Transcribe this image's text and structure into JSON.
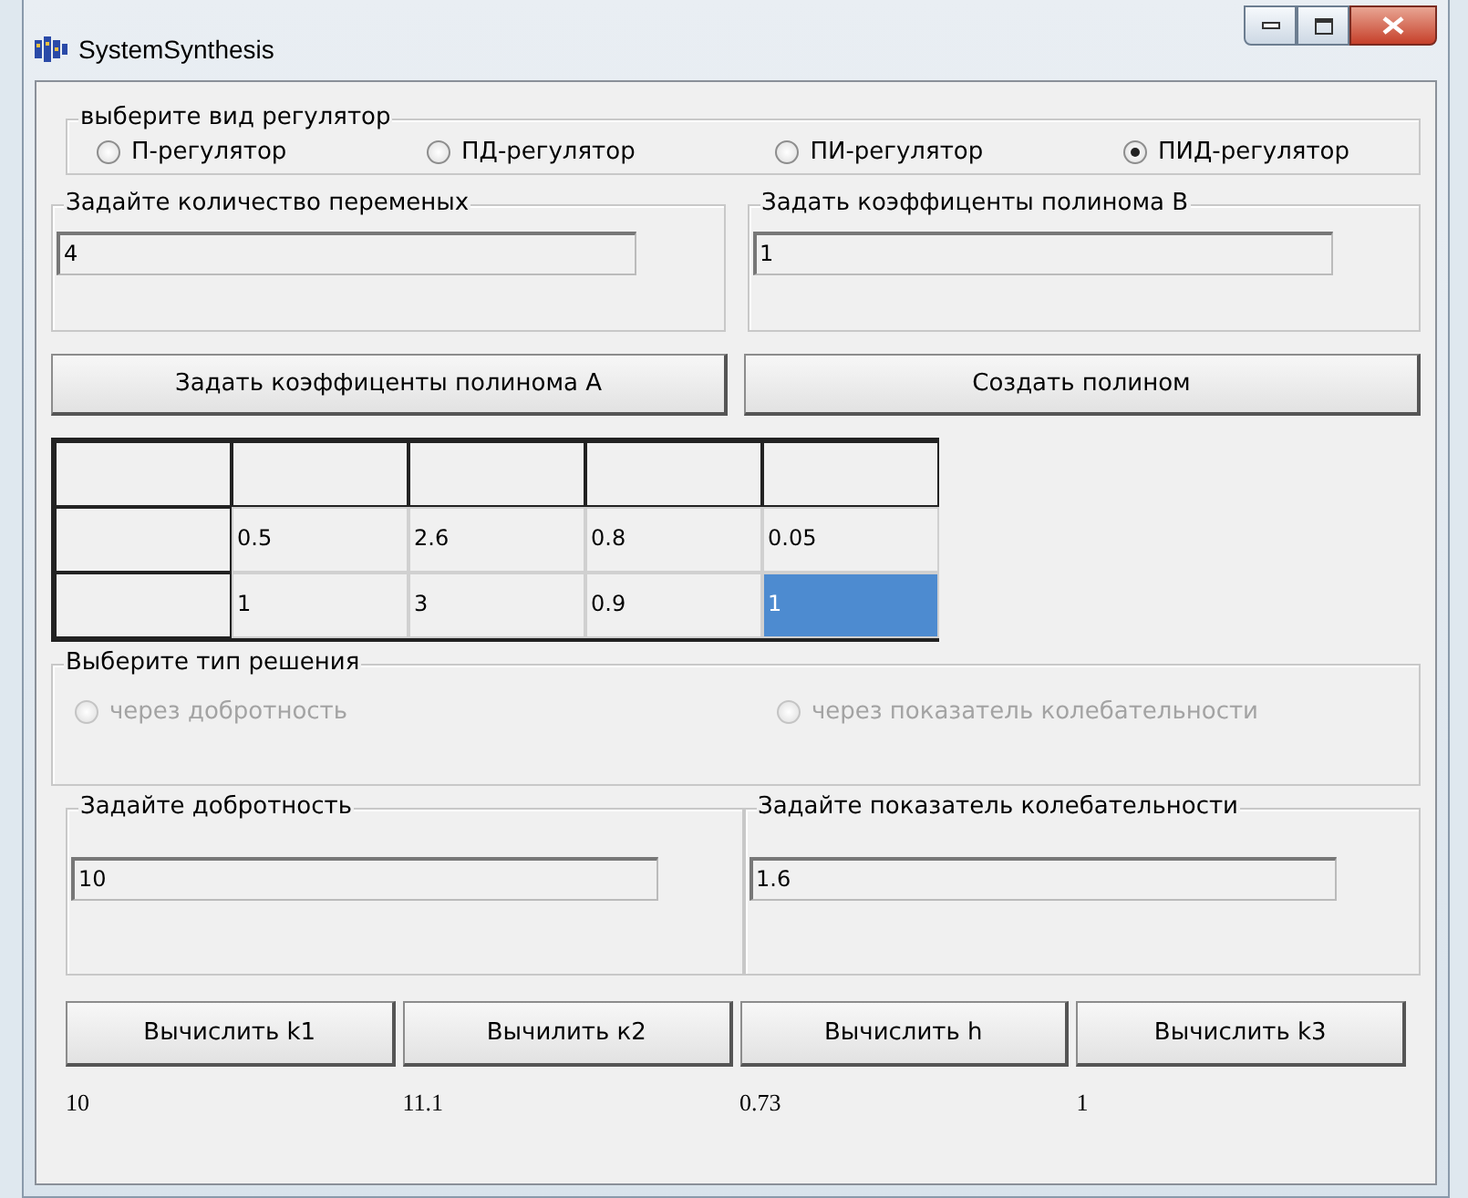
{
  "window": {
    "title": "SystemSynthesis"
  },
  "regulator_group": {
    "label": "выберите вид регулятор",
    "options": [
      {
        "label": "П-регулятор",
        "selected": false
      },
      {
        "label": "ПД-регулятор",
        "selected": false
      },
      {
        "label": "ПИ-регулятор",
        "selected": false
      },
      {
        "label": "ПИД-регулятор",
        "selected": true
      }
    ]
  },
  "variables_group": {
    "label": "Задайте количество переменых",
    "value": "4"
  },
  "poly_b_group": {
    "label": "Задать коэффиценты полинома B",
    "value": "1"
  },
  "poly_buttons": [
    "Задать коэффиценты полинома A",
    "Создать полином"
  ],
  "grid": {
    "rows": [
      {
        "cells": [
          {
            "value": "0.5",
            "selected": false
          },
          {
            "value": "2.6",
            "selected": false
          },
          {
            "value": "0.8",
            "selected": false
          },
          {
            "value": "0.05",
            "selected": false
          }
        ]
      },
      {
        "cells": [
          {
            "value": "1",
            "selected": false
          },
          {
            "value": "3",
            "selected": false
          },
          {
            "value": "0.9",
            "selected": false
          },
          {
            "value": "1",
            "selected": true
          }
        ]
      }
    ]
  },
  "solution_group": {
    "label": "Выберите тип решения",
    "options": [
      {
        "label": "через добротность",
        "selected": false,
        "disabled": true
      },
      {
        "label": "через показатель колебательности",
        "selected": false,
        "disabled": true
      }
    ]
  },
  "quality_group": {
    "label": "Задайте добротность",
    "value": "10"
  },
  "oscillation_group": {
    "label": "Задайте показатель колебательности",
    "value": "1.6"
  },
  "calc_buttons": [
    "Вычислить k1",
    "Вычилить к2",
    "Вычислить h",
    "Вычислить k3"
  ],
  "results": [
    "10",
    "11.1",
    "0.73",
    "1"
  ]
}
